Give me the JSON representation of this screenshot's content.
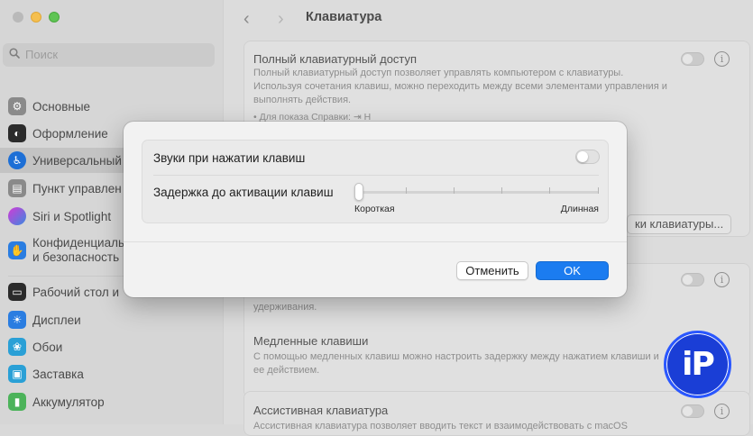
{
  "window": {
    "title": "Клавиатура"
  },
  "search": {
    "placeholder": "Поиск"
  },
  "sidebar": {
    "items": [
      {
        "label": "Основные",
        "icon": "gear-icon",
        "color": "#8a8a8a"
      },
      {
        "label": "Оформление",
        "icon": "appearance-icon",
        "color": "#2b2b2b"
      },
      {
        "label": "Универсальный",
        "icon": "accessibility-icon",
        "color": "#1d6fd6"
      },
      {
        "label": "Пункт управлен",
        "icon": "control-center-icon",
        "color": "#8a8a8a"
      },
      {
        "label": "Siri и Spotlight",
        "icon": "siri-icon",
        "color": "#7a3fd6"
      },
      {
        "label": "Конфиденциаль",
        "label2": "и безопасность",
        "icon": "privacy-hand-icon",
        "color": "#2a7de1"
      },
      {
        "label": "Рабочий стол и",
        "icon": "desktop-dock-icon",
        "color": "#2b2b2b"
      },
      {
        "label": "Дисплеи",
        "icon": "display-icon",
        "color": "#2a7de1"
      },
      {
        "label": "Обои",
        "icon": "wallpaper-icon",
        "color": "#2aa0d6"
      },
      {
        "label": "Заставка",
        "icon": "screensaver-icon",
        "color": "#2aa0d6"
      },
      {
        "label": "Аккумулятор",
        "icon": "battery-icon",
        "color": "#4cb35a"
      }
    ]
  },
  "main": {
    "full_access": {
      "title": "Полный клавиатурный доступ",
      "desc": "Полный клавиатурный доступ позволяет управлять компьютером с клавиатуры. Используя сочетания клавиш, можно переходить между всеми элементами управления и выполнять действия.",
      "hint": "• Для показа Справки: ⇥ H"
    },
    "shortcuts_button": "ки клавиатуры...",
    "hold_desc": "удерживания.",
    "slow_keys": {
      "title": "Медленные клавиши",
      "desc": "С помощью медленных клавиш можно настроить задержку между нажатием клавиши и ее действием."
    },
    "assistive": {
      "title": "Ассистивная клавиатура",
      "desc": "Ассистивная клавиатура позволяет вводить текст и взаимодействовать с macOS"
    }
  },
  "dialog": {
    "sound_label": "Звуки при нажатии клавиш",
    "sound_enabled": false,
    "delay_label": "Задержка до активации клавиш",
    "delay_min_label": "Короткая",
    "delay_max_label": "Длинная",
    "delay_value": 0,
    "delay_ticks": 6,
    "cancel_label": "Отменить",
    "ok_label": "OK",
    "accent": "#1b7cf0"
  },
  "watermark": {
    "text": "iP",
    "color": "#1a3ed6"
  }
}
